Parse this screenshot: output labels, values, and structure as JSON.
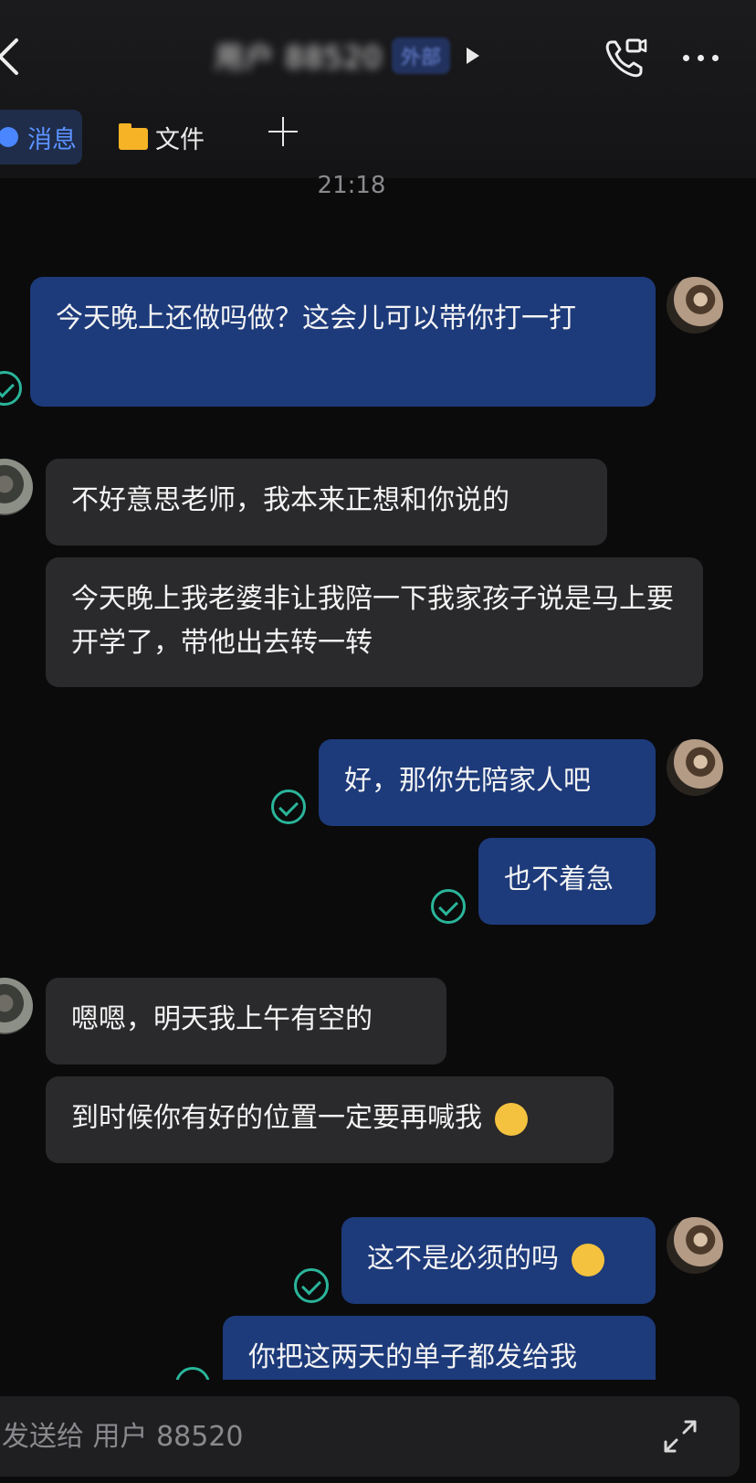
{
  "header": {
    "title": "用户 88520",
    "badge": "外部"
  },
  "tabs": [
    {
      "label": "消息"
    },
    {
      "label": "文件"
    }
  ],
  "timestamp": "21:18",
  "messages": [
    {
      "side": "out",
      "text": "今天晚上还做吗做？这会儿可以带你打一打"
    },
    {
      "side": "in",
      "text": "不好意思老师，我本来正想和你说的"
    },
    {
      "side": "in",
      "text": "今天晚上我老婆非让我陪一下我家孩子说是马上要开学了，带他出去转一转"
    },
    {
      "side": "out",
      "text": "好，那你先陪家人吧"
    },
    {
      "side": "out",
      "text": "也不着急"
    },
    {
      "side": "in",
      "text": "嗯嗯，明天我上午有空的"
    },
    {
      "side": "in",
      "text": "到时候你有好的位置一定要再喊我"
    },
    {
      "side": "out",
      "text": "这不是必须的吗"
    },
    {
      "side": "out",
      "text": "你把这两天的单子都发给我"
    }
  ],
  "input": {
    "placeholder": "发送给 用户 88520"
  },
  "colors": {
    "outgoing_bubble": "#1d3a7a",
    "incoming_bubble": "#2a2a2c",
    "read_check": "#2ab59a",
    "tab_active": "#5b93ff"
  },
  "icons": [
    "back-arrow-icon",
    "video-call-icon",
    "more-icon",
    "folder-icon",
    "add-icon",
    "read-check-icon",
    "expand-icon"
  ]
}
